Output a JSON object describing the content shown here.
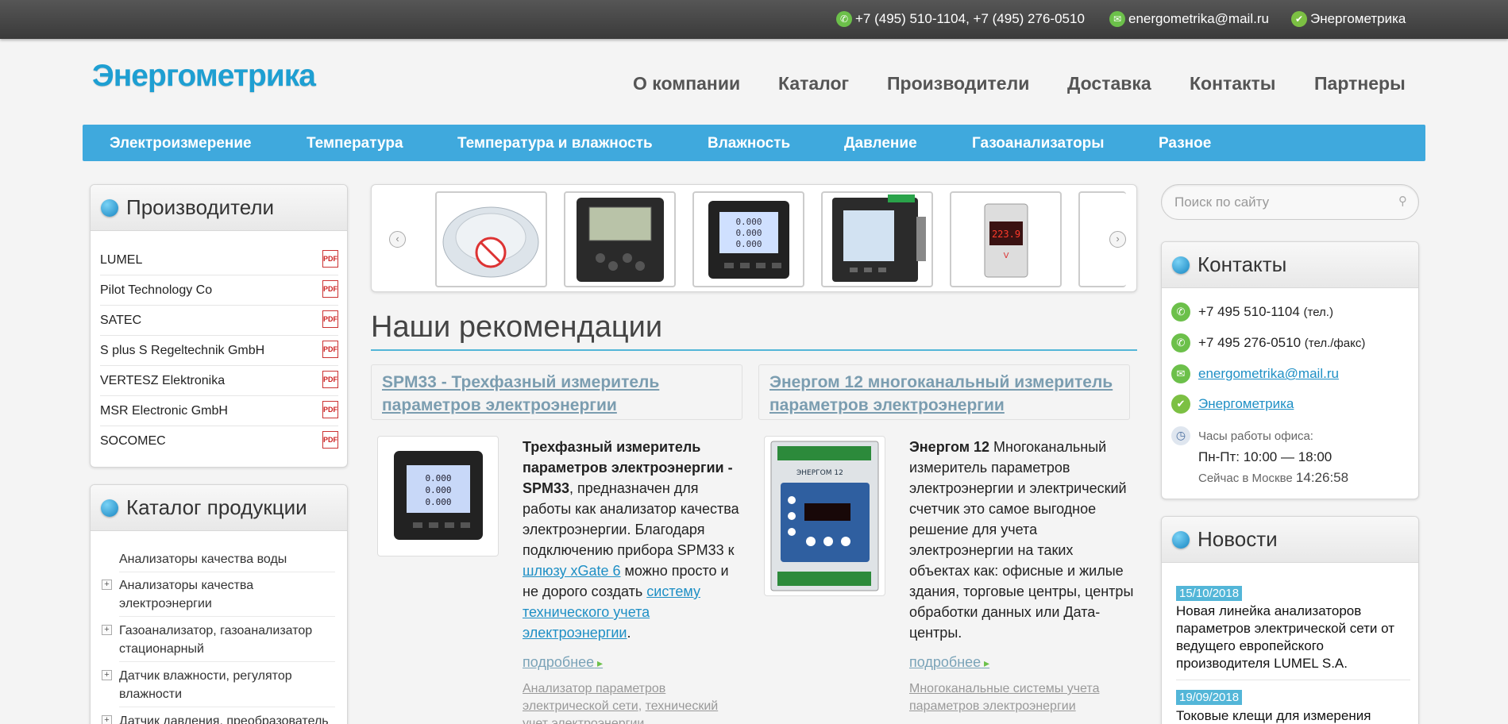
{
  "topbar": {
    "phones": "+7 (495) 510-1104, +7 (495) 276-0510",
    "email": "energometrika@mail.ru",
    "social": "Энергометрика"
  },
  "logo": "Энергометрика",
  "main_nav": [
    "О компании",
    "Каталог",
    "Производители",
    "Доставка",
    "Контакты",
    "Партнеры"
  ],
  "category_nav": [
    "Электроизмерение",
    "Температура",
    "Температура и влажность",
    "Влажность",
    "Давление",
    "Газоанализаторы",
    "Разное"
  ],
  "manufacturers": {
    "title": "Производители",
    "items": [
      "LUMEL",
      "Pilot Technology Co",
      "SATEC",
      "S plus S Regeltechnik GmbH",
      "VERTESZ Elektronika",
      "MSR Electronic GmbH",
      "SOCOMEC"
    ]
  },
  "catalog": {
    "title": "Каталог продукции",
    "items": [
      {
        "label": "Анализаторы качества воды",
        "expandable": false
      },
      {
        "label": "Анализаторы качества электроэнергии",
        "expandable": true
      },
      {
        "label": "Газоанализатор, газоанализатор стационарный",
        "expandable": true
      },
      {
        "label": "Датчик влажности, регулятор влажности",
        "expandable": true
      },
      {
        "label": "Датчик давления, преобразователь",
        "expandable": true
      }
    ]
  },
  "slider": {
    "prev_icon": "chevron-left-icon",
    "next_icon": "chevron-right-icon",
    "lcd": [
      "0.000",
      "0.000",
      "0.000"
    ],
    "meter_value": "223.9",
    "meter_unit": "V"
  },
  "recommendations": {
    "title": "Наши рекомендации",
    "products": [
      {
        "title": "SPM33 - Трехфазный измеритель параметров электроэнергии",
        "desc_bold": "Трехфазный измеритель параметров электроэнергии - SPM33",
        "desc_1": ", предназначен для работы как анализатор качества электроэнергии. Благодаря подключению прибора SPM33 к ",
        "link_1": "шлюзу xGate 6",
        "desc_2": " можно просто и не дорого создать ",
        "link_2": "систему технического учета электроэнергии",
        "desc_3": ".",
        "more": "подробнее",
        "tag_1": "Анализатор параметров электрической сети",
        "tag_2": "технический учет электроэнергии"
      },
      {
        "title": "Энергом 12 многоканальный измеритель параметров электроэнергии",
        "desc_bold": "Энергом 12",
        "desc_1": " Многоканальный измеритель параметров электроэнергии и электрический счетчик это самое выгодное  решение для учета электроэнергии на таких объектах как: офисные и жилые здания, торговые центры, центры обработки данных или Дата-центры.",
        "more": "подробнее",
        "tag_1": "Многоканальные системы учета параметров электроэнергии",
        "device_label": "ЭНЕРГОМ 12"
      }
    ]
  },
  "search": {
    "placeholder": "Поиск по сайту"
  },
  "contacts": {
    "title": "Контакты",
    "phone_1": "+7 495 510-1104",
    "phone_1_note": "(тел.)",
    "phone_2": "+7 495 276-0510",
    "phone_2_note": "(тел./факс)",
    "email": "energometrika@mail.ru",
    "social": "Энергометрика",
    "hours_label": "Часы работы офиса:",
    "hours": "Пн-Пт: 10:00 — 18:00",
    "now_label": "Сейчас в Москве",
    "now_time": "14:26:58"
  },
  "news": {
    "title": "Новости",
    "items": [
      {
        "date": "15/10/2018",
        "text": "Новая линейка анализаторов параметров электрической сети от ведущего европейского производителя LUMEL S.A."
      },
      {
        "date": "19/09/2018",
        "text": "Токовые клещи для измерения"
      }
    ]
  },
  "colors": {
    "accent": "#3fa9dd",
    "green": "#6cc04a",
    "link": "#7b9db0"
  }
}
